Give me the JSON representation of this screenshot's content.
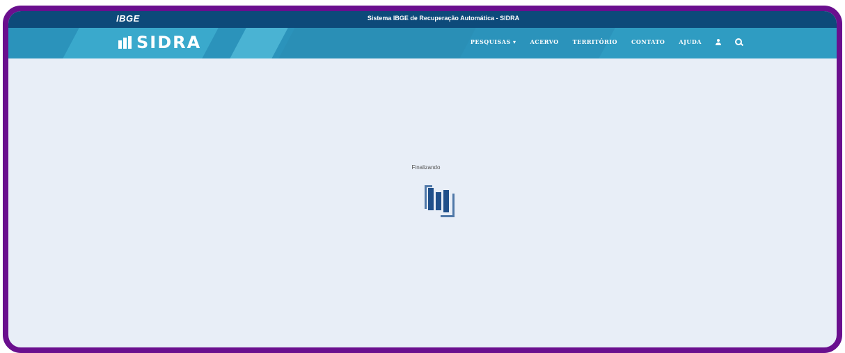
{
  "header": {
    "ibge_logo": "IBGE",
    "system_title": "Sistema IBGE de Recuperação Automática - SIDRA"
  },
  "nav": {
    "logo_text": "SIDRA",
    "items": [
      {
        "label": "PESQUISAS",
        "has_dropdown": true
      },
      {
        "label": "ACERVO"
      },
      {
        "label": "TERRITÓRIO"
      },
      {
        "label": "CONTATO"
      },
      {
        "label": "AJUDA"
      }
    ],
    "icons": [
      "user-icon",
      "search-icon"
    ]
  },
  "main": {
    "status": "Finalizando",
    "loader_icon": "sidra-bars-icon"
  },
  "colors": {
    "frame_border": "#6a0f8e",
    "top_strip": "#0d4a7a",
    "nav_bar": "#2b93bb",
    "background": "#e8eef7",
    "loader": "#1f4f8a"
  }
}
